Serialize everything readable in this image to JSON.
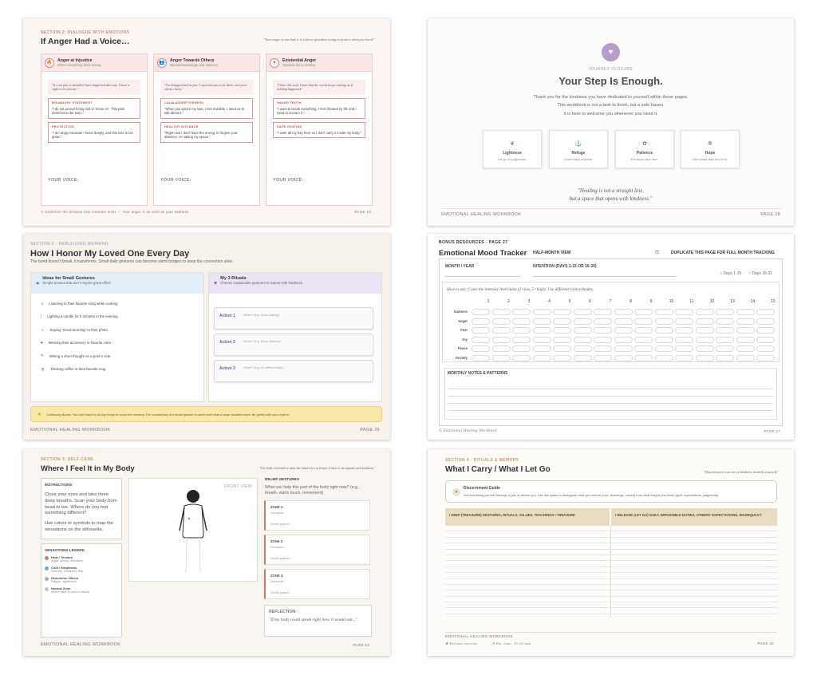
{
  "p1": {
    "section": "SECTION 2: DIALOGUE WITH EMOTIONS",
    "title": "If Anger Had a Voice…",
    "quote": "\"Your anger is not bad, it is a fierce guardian trying to protect what you loved.\"",
    "cols": [
      {
        "icon": "🔥",
        "title": "Anger at Injustice",
        "sub": "When everything feels wrong",
        "quote": "\"It's not fair, it shouldn't have happened this way. I have a right to be furious.\"",
        "b1": "BOUNDARY STATEMENT",
        "t1": "\"I do not accept being told to 'move on'. This pain deserves to be seen.\"",
        "b2": "PROTECTION",
        "t2": "\"I am angry because I loved deeply, and this loss is too great.\"",
        "voice": "YOUR VOICE:"
      },
      {
        "icon": "👥",
        "title": "Anger Towards Others",
        "sub": "Misunderstandings and absence",
        "quote": "\"I'm disappointed in you. I expected you to be there, and your silence hurts.\"",
        "b1": "CALM ASSERTIVENESS",
        "t1": "\"When you ignore my loss, I feel invisible. I need us to talk about it.\"",
        "b2": "HEALTHY DISTANCE",
        "t2": "\"Right now I don't have the energy to forgive your absence. I'm taking my space.\"",
        "voice": "YOUR VOICE:"
      },
      {
        "icon": "✦",
        "title": "Existential Anger",
        "sub": "Towards life or destiny",
        "quote": "\"I hate this void. I hate that the world keeps turning as if nothing happened.\"",
        "b1": "NAKED TRUTH",
        "t1": "\"I want to break everything. I feel cheated by life and I need to scream it.\"",
        "b2": "SAFE VENTING",
        "t2": "\"I write all my fury here so I don't carry it inside my body.\"",
        "voice": "YOUR VOICE:"
      }
    ],
    "footer_left": "✎ Underline the phrases that resonate most.   ♡ Your anger is as valid as your sadness.",
    "page": "PAGE 10"
  },
  "p2": {
    "eyebrow": "JOURNEY CLOSURE",
    "title": "Your Step Is Enough.",
    "line1": "Thank you for the kindness you have dedicated to yourself within these pages.",
    "line2": "This workbook is not a task to finish, but a safe haven.",
    "line3": "It is here to welcome you whenever you need it.",
    "cards": [
      {
        "icon": "❦",
        "t": "Lightness",
        "d": "Let go of judgments."
      },
      {
        "icon": "⚓",
        "t": "Refuge",
        "d": "Come back anytime."
      },
      {
        "icon": "✿",
        "t": "Patience",
        "d": "Emotions take time."
      },
      {
        "icon": "❁",
        "t": "Hope",
        "d": "One small step at a time."
      }
    ],
    "q1": "\"Healing is not a straight line,",
    "q2": "but a space that opens with kindness.\"",
    "footer": "EMOTIONAL HEALING WORKBOOK",
    "page": "PAGE 28"
  },
  "p3": {
    "section": "SECTION 5 - REBUILDING MEANING",
    "title": "How I Honor My Loved One Every Day",
    "sub": "The bond doesn't break, it transforms. Small daily gestures can become silent bridges to keep the connection alive.",
    "left_title": "Ideas for Small Gestures",
    "left_sub": "Simple actions that don't require great effort.",
    "items": [
      {
        "icon": "♫",
        "t": "Listening to their favorite song while cooking"
      },
      {
        "icon": "🕯",
        "t": "Lighting a candle for 5 minutes in the evening"
      },
      {
        "icon": "☺",
        "t": "Saying \"Good morning\" to their photo"
      },
      {
        "icon": "♥",
        "t": "Wearing their accessory or favorite color"
      },
      {
        "icon": "✎",
        "t": "Writing a short thought on a post-it note"
      },
      {
        "icon": "☕",
        "t": "Drinking coffee in their favorite mug"
      }
    ],
    "right_title": "My 3 Rituals",
    "right_sub": "Choose sustainable gestures to repeat with kindness.",
    "actions": [
      {
        "a": "Action 1",
        "h": "When? (e.g. Upon waking)"
      },
      {
        "a": "Action 2",
        "h": "When? (e.g. Every Sunday)"
      },
      {
        "a": "Action 3",
        "h": "When? (e.g. On difficult days)"
      }
    ],
    "bonus": "Continuing Bonds: You don't have to do big things to honor the memory. The consistency of a small gesture is worth more than a large isolated event. Be gentle with your rhythm.",
    "footer": "EMOTIONAL HEALING WORKBOOK",
    "page": "PAGE 25"
  },
  "p4": {
    "section": "BONUS RESOURCES - PAGE 27",
    "title": "Emotional Mood Tracker",
    "view": "HALF-MONTH VIEW",
    "dup": "DUPLICATE THIS PAGE FOR FULL MONTH TRACKING",
    "month": "MONTH / YEAR",
    "intention": "INTENTION (DAYS 1-15 OR 16-30)",
    "opt1": "Days 1-15",
    "opt2": "Days 16-31",
    "howto": "How to use: Color the intensity level daily (1=low, 5=high). Use different colors/shades.",
    "days": [
      "1",
      "2",
      "3",
      "4",
      "5",
      "6",
      "7",
      "8",
      "9",
      "10",
      "11",
      "12",
      "13",
      "14",
      "15"
    ],
    "rows": [
      "Sadness",
      "Anger",
      "Fear",
      "Joy",
      "Peace",
      "Anxiety"
    ],
    "notes": "MONTHLY NOTES & PATTERNS",
    "footer": "© Emotional Healing Workbook",
    "page": "PAGE 27"
  },
  "p5": {
    "section": "SECTION 3: SELF-CARE",
    "title": "Where I Feel It in My Body",
    "quote": "\"The body remembers what the mind tries to forget. Listen to its signals with kindness.\"",
    "instr_title": "INSTRUCTIONS",
    "instr1": "Close your eyes and take three deep breaths. Scan your body from head to toe. Where do you feel something different?",
    "instr2": "Use colors or symbols to map the sensations on the silhouette.",
    "legend_title": "SENSATIONS LEGEND",
    "legend": [
      {
        "c": "#e07b5a",
        "t": "Heat / Tension",
        "d": "Anger, anxiety, activation"
      },
      {
        "c": "#7fa3c7",
        "t": "Cold / Emptiness",
        "d": "Sadness, loneliness, fear"
      },
      {
        "c": "#b7a7cf",
        "t": "Heaviness / Block",
        "d": "Fatigue, oppression"
      },
      {
        "c": "#c9c6c0",
        "t": "Neutral Zone",
        "d": "Where there is calm or silence"
      }
    ],
    "front": "FRONT VIEW",
    "relief_title": "RELIEF GESTURES",
    "relief_q": "What can help this part of the body right now? (e.g., breath, warm touch, movement)",
    "zones": [
      {
        "z": "ZONE 1:",
        "s": "Sensation:",
        "g": "Gentle gesture:"
      },
      {
        "z": "ZONE 2:",
        "s": "Sensation:",
        "g": "Gentle gesture:"
      },
      {
        "z": "ZONE 3:",
        "s": "Sensation:",
        "g": "Gentle gesture:"
      }
    ],
    "refl_title": "REFLECTION:",
    "refl": "\"If my body could speak right now, it would ask...\"",
    "footer": "EMOTIONAL HEALING WORKBOOK",
    "page": "PAGE 12"
  },
  "p6": {
    "section": "SECTION 4 - RITUALS & MEMORY",
    "title": "What I Carry / What I Let Go",
    "quote": "\"Discernment is an act of kindness towards yourself.\"",
    "guide_title": "Discernment Guide",
    "guide": "Not everything you feel belongs to you or serves you. Use this space to distinguish what you nurture (love, teachings, values) from what weighs you down (guilt, expectations, judgments).",
    "col1": "I KEEP (TREASURE) GESTURES, RITUALS, VALUES, TEACHINGS I TREASURE",
    "col2": "I RELEASE (LET GO) GUILT, IMPOSSIBLE DUTIES, OTHERS' EXPECTATIONS, INADEQUACY",
    "footer": "EMOTIONAL HEALING WORKBOOK",
    "ex": "Release exercise",
    "time": "Est. time: 15-20 min",
    "page": "PAGE 30"
  }
}
